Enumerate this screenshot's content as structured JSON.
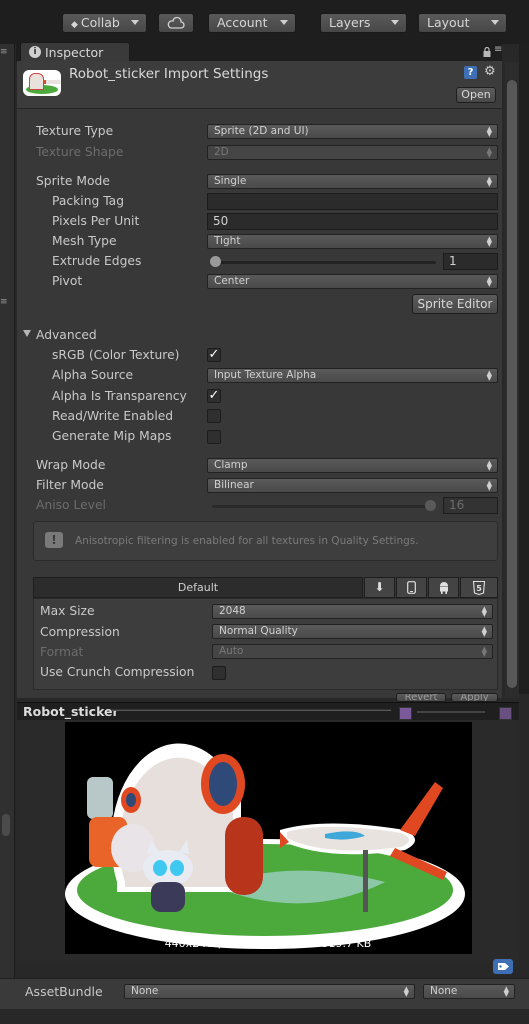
{
  "toolbar": {
    "collab_label": "Collab",
    "account_label": "Account",
    "layers_label": "Layers",
    "layout_label": "Layout"
  },
  "inspector": {
    "tab_label": "Inspector",
    "title": "Robot_sticker Import Settings",
    "open_label": "Open"
  },
  "settings": {
    "texture_type": {
      "label": "Texture Type",
      "value": "Sprite (2D and UI)"
    },
    "texture_shape": {
      "label": "Texture Shape",
      "value": "2D"
    },
    "sprite_mode": {
      "label": "Sprite Mode",
      "value": "Single"
    },
    "packing_tag": {
      "label": "Packing Tag",
      "value": ""
    },
    "pixels_per_unit": {
      "label": "Pixels Per Unit",
      "value": "50"
    },
    "mesh_type": {
      "label": "Mesh Type",
      "value": "Tight"
    },
    "extrude_edges": {
      "label": "Extrude Edges",
      "value": "1",
      "slider_fraction": 0.0
    },
    "pivot": {
      "label": "Pivot",
      "value": "Center"
    },
    "sprite_editor_label": "Sprite Editor",
    "advanced_label": "Advanced",
    "srgb": {
      "label": "sRGB (Color Texture)",
      "checked": true
    },
    "alpha_source": {
      "label": "Alpha Source",
      "value": "Input Texture Alpha"
    },
    "alpha_is_transparency": {
      "label": "Alpha Is Transparency",
      "checked": true
    },
    "read_write": {
      "label": "Read/Write Enabled",
      "checked": false
    },
    "mip_maps": {
      "label": "Generate Mip Maps",
      "checked": false
    },
    "wrap_mode": {
      "label": "Wrap Mode",
      "value": "Clamp"
    },
    "filter_mode": {
      "label": "Filter Mode",
      "value": "Bilinear"
    },
    "aniso_level": {
      "label": "Aniso Level",
      "value": "16",
      "slider_fraction": 1.0
    },
    "aniso_note": "Anisotropic filtering is enabled for all textures in Quality Settings."
  },
  "platform": {
    "default_tab": "Default",
    "icons": [
      "download-icon",
      "mobile-icon",
      "android-icon",
      "html5-icon"
    ],
    "max_size": {
      "label": "Max Size",
      "value": "2048"
    },
    "compression": {
      "label": "Compression",
      "value": "Normal Quality"
    },
    "format": {
      "label": "Format",
      "value": "Auto"
    },
    "crunch": {
      "label": "Use Crunch Compression",
      "checked": false
    },
    "revert_label": "Revert",
    "apply_label": "Apply"
  },
  "preview": {
    "title": "Robot_sticker",
    "info": "440x248 (NPOT)  RGB 24 bit   319.7 KB"
  },
  "assetbundle": {
    "label": "AssetBundle",
    "name_value": "None",
    "variant_value": "None"
  },
  "colors": {
    "background": "#383838",
    "accent_blue": "#3e6fb5",
    "sticker_green": "#4caa3c"
  }
}
